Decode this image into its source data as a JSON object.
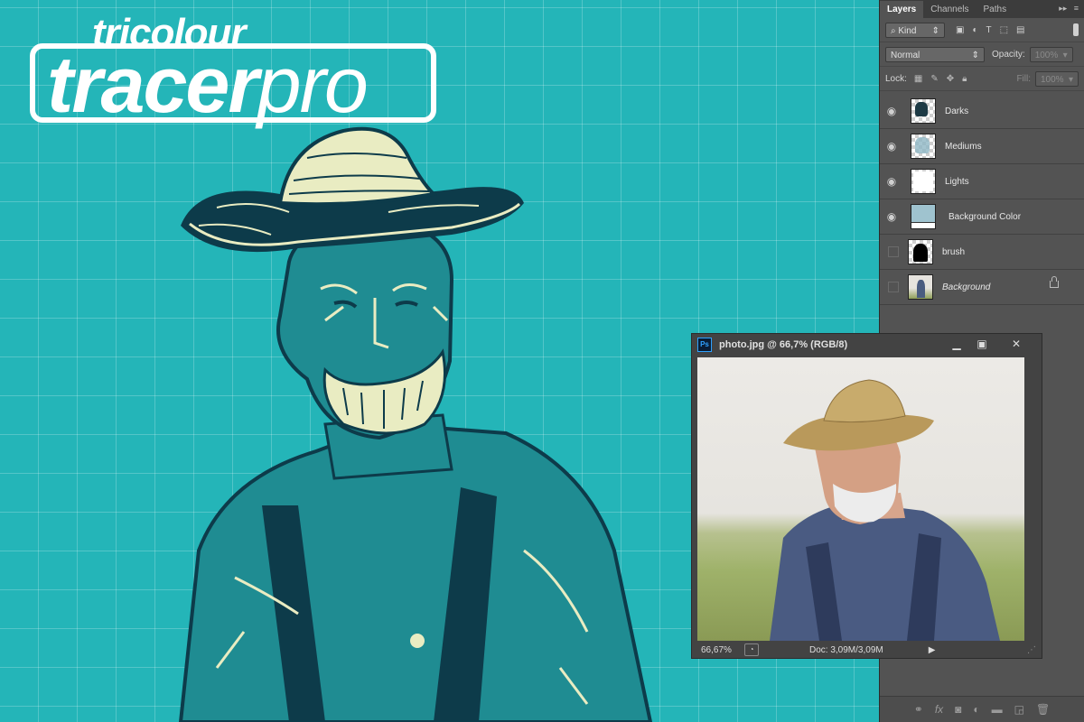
{
  "logo": {
    "small": "tricolour",
    "main_bold": "tracer",
    "main_light": "pro"
  },
  "panel": {
    "tabs": [
      "Layers",
      "Channels",
      "Paths"
    ],
    "filter_kind": "Kind",
    "blend_mode": "Normal",
    "opacity_label": "Opacity:",
    "opacity_value": "100%",
    "lock_label": "Lock:",
    "fill_label": "Fill:",
    "fill_value": "100%",
    "layers": [
      {
        "name": "Darks",
        "visible": true
      },
      {
        "name": "Mediums",
        "visible": true
      },
      {
        "name": "Lights",
        "visible": true
      },
      {
        "name": "Background Color",
        "visible": true
      },
      {
        "name": "brush",
        "visible": false
      },
      {
        "name": "Background",
        "visible": false,
        "locked": true
      }
    ]
  },
  "document": {
    "title": "photo.jpg @ 66,7% (RGB/8)",
    "app_badge": "Ps",
    "zoom": "66,67%",
    "doc_size": "Doc: 3,09M/3,09M"
  },
  "colors": {
    "canvas": "#24b5b8",
    "dark": "#0d3b4a",
    "cream": "#e9ecc2",
    "panel": "#535353"
  }
}
